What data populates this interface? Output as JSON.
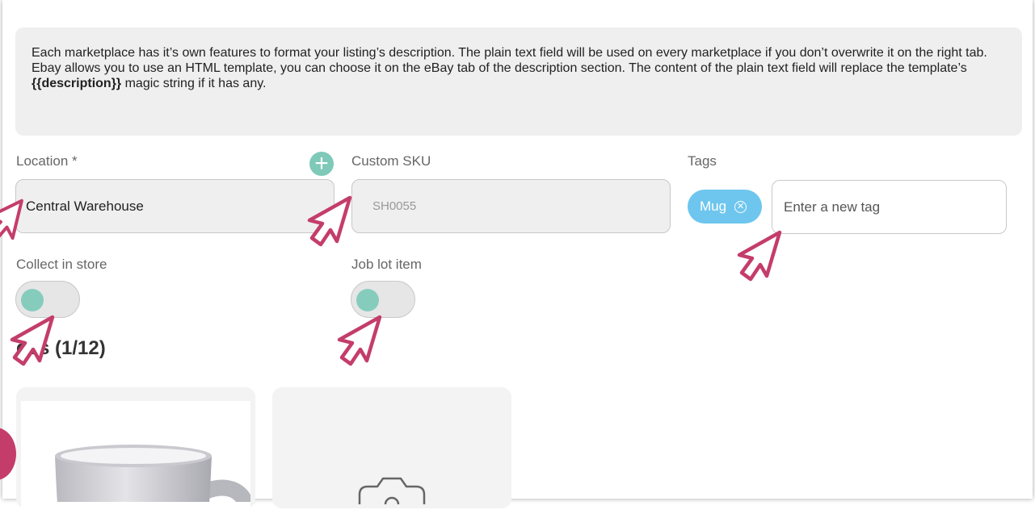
{
  "info": {
    "line1": "Each marketplace has it’s own features to format your listing’s description. The plain text field will be used on every marketplace if you don’t overwrite it on the right tab.",
    "line2_prefix": "Ebay allows you to use an HTML template, you can choose it on the eBay tab of the description section. The content of the plain text field will replace the template’s ",
    "line2_magic": "{{description}}",
    "line2_suffix": " magic string if it has any."
  },
  "location": {
    "label": "Location *",
    "value": "Central Warehouse",
    "add_icon": "plus-icon"
  },
  "custom_sku": {
    "label": "Custom SKU",
    "placeholder": "SH0055"
  },
  "tags": {
    "label": "Tags",
    "chips": [
      "Mug"
    ],
    "remove_icon": "close-circle-icon",
    "placeholder": "Enter a new tag"
  },
  "collect_in_store": {
    "label": "Collect in store",
    "on": false
  },
  "job_lot_item": {
    "label": "Job lot item",
    "on": false
  },
  "images": {
    "title": "ges (1/12)",
    "upload_icon": "camera-icon"
  },
  "colors": {
    "accent_teal": "#7ec9b8",
    "tag_blue": "#6ec6ee",
    "cursor_pink": "#c43d6a",
    "panel_gray": "#efefef"
  }
}
